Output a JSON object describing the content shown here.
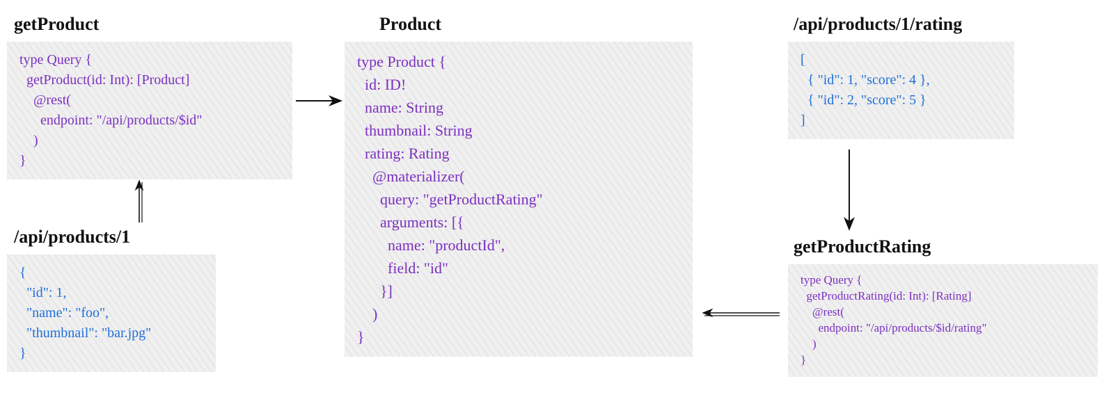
{
  "headings": {
    "getProduct": "getProduct",
    "product": "Product",
    "ratingApi": "/api/products/1/rating",
    "productApi": "/api/products/1",
    "getProductRating": "getProductRating"
  },
  "blocks": {
    "getProduct": "type Query {\n  getProduct(id: Int): [Product]\n    @rest(\n      endpoint: \"/api/products/$id\"\n    )\n}",
    "productApi": "{\n  \"id\": 1,\n  \"name\": \"foo\",\n  \"thumbnail\": \"bar.jpg\"\n}",
    "product": "type Product {\n  id: ID!\n  name: String\n  thumbnail: String\n  rating: Rating\n    @materializer(\n      query: \"getProductRating\"\n      arguments: [{\n        name: \"productId\",\n        field: \"id\"\n      }]\n    )\n}",
    "ratingApi": "[\n  { \"id\": 1, \"score\": 4 },\n  { \"id\": 2, \"score\": 5 }\n]",
    "getProductRating": "type Query {\n  getProductRating(id: Int): [Rating]\n    @rest(\n      endpoint: \"/api/products/$id/rating\"\n    )\n}"
  }
}
